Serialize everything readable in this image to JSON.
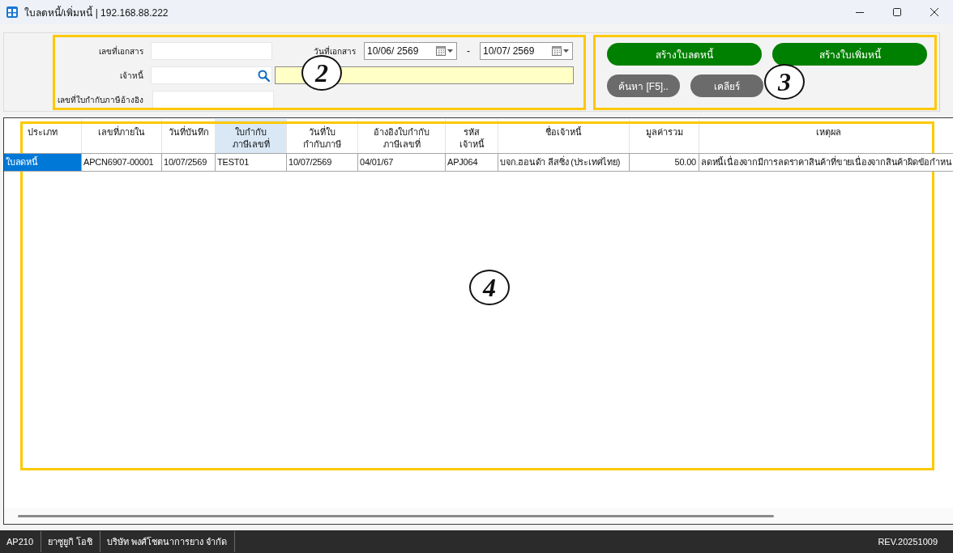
{
  "window": {
    "title": "ใบลดหนี้/เพิ่มหนี้ | 192.168.88.222"
  },
  "filters": {
    "document_number": {
      "label": "เลขที่เอกสาร"
    },
    "document_date": {
      "label": "วันที่เอกสาร",
      "from": "10/06/ 2569",
      "separator": "-",
      "to": "10/07/ 2569"
    },
    "creditor": {
      "label": "เจ้าหนี้"
    },
    "tax_invoice_reference": {
      "label": "เลขที่ใบกำกับภาษีอ้างอิง"
    },
    "annotation": {
      "label": "2"
    }
  },
  "actions": {
    "buttons": [
      {
        "label": "สร้างใบลดหนี้",
        "kind": "primary"
      },
      {
        "label": "สร้างใบเพิ่มหนี้",
        "kind": "primary"
      },
      {
        "label": "ค้นหา [F5]..",
        "kind": "secondary"
      },
      {
        "label": "เคลียร์",
        "kind": "secondary"
      }
    ],
    "annotation": {
      "label": "3"
    }
  },
  "table": {
    "columns": [
      {
        "label": "ประเภท",
        "selected": false
      },
      {
        "label": "เลขที่ภายใน",
        "selected": false
      },
      {
        "label": "วันที่บันทึก",
        "selected": false
      },
      {
        "label": "ใบกำกับ\nภาษีเลขที่",
        "selected": true
      },
      {
        "label": "วันที่ใบ\nกำกับภาษี",
        "selected": false
      },
      {
        "label": "อ้างอิงใบกำกับ\nภาษีเลขที่",
        "selected": false
      },
      {
        "label": "รหัส\nเจ้าหนี้",
        "selected": false
      },
      {
        "label": "ชื่อเจ้าหนี้",
        "selected": false
      },
      {
        "label": "มูลค่ารวม",
        "selected": false
      },
      {
        "label": "เหตุผล",
        "selected": false
      }
    ],
    "rows": [
      {
        "cells": [
          {
            "text": "ใบลดหนี้",
            "selected": true
          },
          {
            "text": "APCN6907-00001",
            "selected": false
          },
          {
            "text": "10/07/2569",
            "selected": false
          },
          {
            "text": "TEST01",
            "selected": false
          },
          {
            "text": "10/07/2569",
            "selected": false
          },
          {
            "text": "04/01/67",
            "selected": false
          },
          {
            "text": "APJ064",
            "selected": false
          },
          {
            "text": "บจก.ฮอนด้า ลีสซิ่ง (ประเทศไทย)",
            "selected": false
          },
          {
            "text": "50.00",
            "selected": false
          },
          {
            "text": "ลดหนี้เนื่องจากมีการลดราคาสินค้าที่ขายเนื่องจากสินค้าผิดข้อกำหน",
            "selected": false
          }
        ]
      }
    ],
    "annotation": {
      "label": "4"
    }
  },
  "status_bar": {
    "items": [
      "AP210",
      "ยาซูยูกิ โอชิ",
      "บริษัท พงศ์โชตนาการยาง จำกัด"
    ],
    "revision": "REV.20251009"
  }
}
